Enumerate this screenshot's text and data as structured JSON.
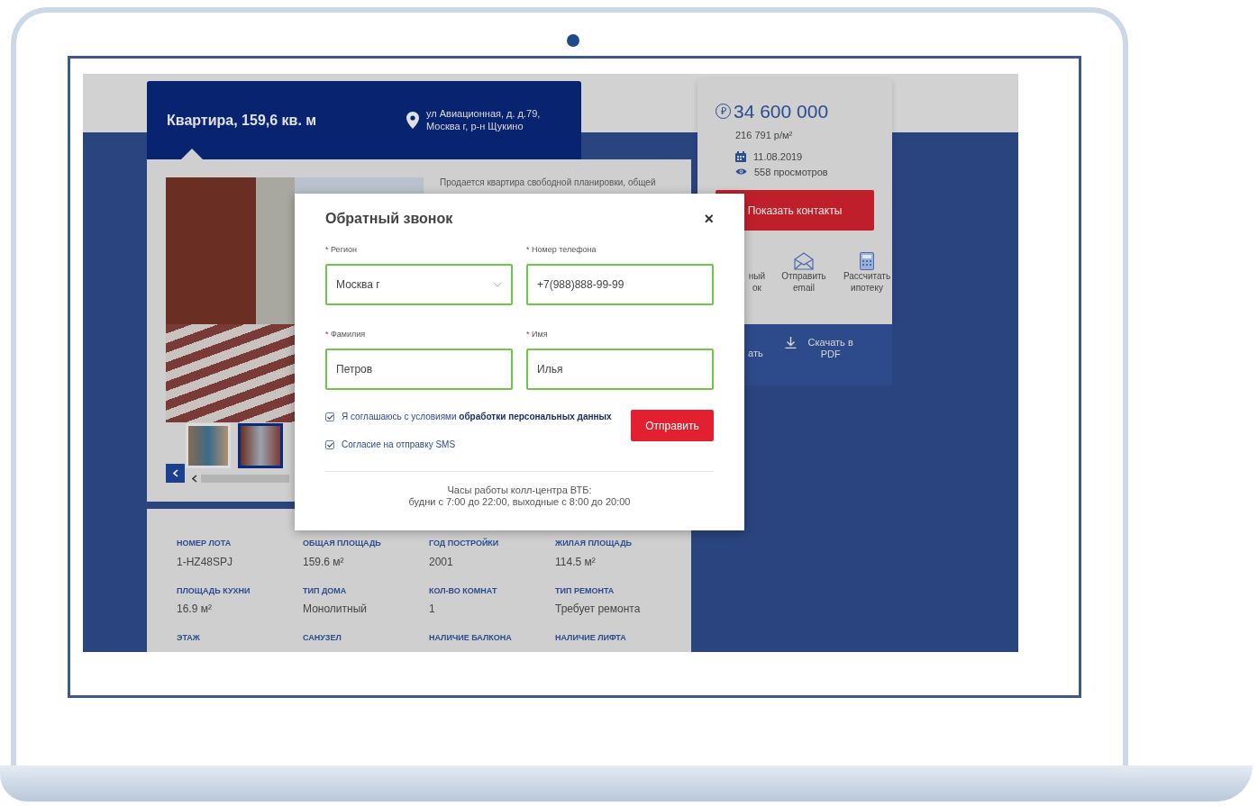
{
  "listing": {
    "title": "Квартира, 159,6 кв. м",
    "address": [
      "ул Авиационная, д. д.79,",
      "Москва г, р-н Щукино"
    ]
  },
  "description": [
    "Продается квартира свободной планировки, общей"
  ],
  "gallery": {
    "thumbnails": [
      {
        "selected": false
      },
      {
        "selected": true
      }
    ]
  },
  "specs": [
    {
      "label": "НОМЕР ЛОТА",
      "value": "1-HZ48SPJ"
    },
    {
      "label": "ОБЩАЯ ПЛОЩАДЬ",
      "value": "159.6 м²"
    },
    {
      "label": "ГОД ПОСТРОЙКИ",
      "value": "2001"
    },
    {
      "label": "ЖИЛАЯ ПЛОЩАДЬ",
      "value": "114.5 м²"
    },
    {
      "label": "ПЛОЩАДЬ КУХНИ",
      "value": "16.9 м²"
    },
    {
      "label": "ТИП ДОМА",
      "value": "Монолитный"
    },
    {
      "label": "КОЛ-ВО КОМНАТ",
      "value": "1"
    },
    {
      "label": "ТИП РЕМОНТА",
      "value": "Требует ремонта"
    },
    {
      "label": "ЭТАЖ"
    },
    {
      "label": "САНУЗЕЛ"
    },
    {
      "label": "НАЛИЧИЕ БАЛКОНА"
    },
    {
      "label": "НАЛИЧИЕ ЛИФТА"
    }
  ],
  "price": {
    "currency": "₽",
    "amount": "34 600 000",
    "per_meter": "216 791 р/м²",
    "date": "11.08.2019",
    "views": "558 просмотров"
  },
  "contacts_button": "Показать контакты",
  "actions": [
    {
      "kind": "callback",
      "label": "ный ок"
    },
    {
      "kind": "email",
      "label": "Отправить email"
    },
    {
      "kind": "mortgage",
      "label": "Рассчитать ипотеку"
    }
  ],
  "extra_actions": [
    {
      "kind": "print",
      "label": "ать"
    },
    {
      "kind": "pdf",
      "label": "Скачать в PDF"
    }
  ],
  "modal": {
    "title": "Обратный звонок",
    "close": "×",
    "fields": [
      {
        "kind": "select",
        "required_mark": "*",
        "label": "Регион",
        "value": "Москва г"
      },
      {
        "kind": "text",
        "required_mark": "*",
        "label": "Номер телефона",
        "value": "+7(988)888-99-99"
      },
      {
        "kind": "text",
        "required_mark": "*",
        "label": "Фамилия",
        "value": "Петров"
      },
      {
        "kind": "text",
        "required_mark": "*",
        "label": "Имя",
        "value": "Илья"
      }
    ],
    "consents": [
      {
        "label": "Я соглашаюсь с условиями **обработки персональных данных**",
        "checked": true
      },
      {
        "label": "Согласие на отправку SMS",
        "checked": true
      }
    ],
    "submit": "Отправить",
    "footer": [
      "Часы работы колл-центра ВТБ:",
      "будни с 7:00 до 22:00, выходные с 8:00 до 20:00"
    ]
  }
}
